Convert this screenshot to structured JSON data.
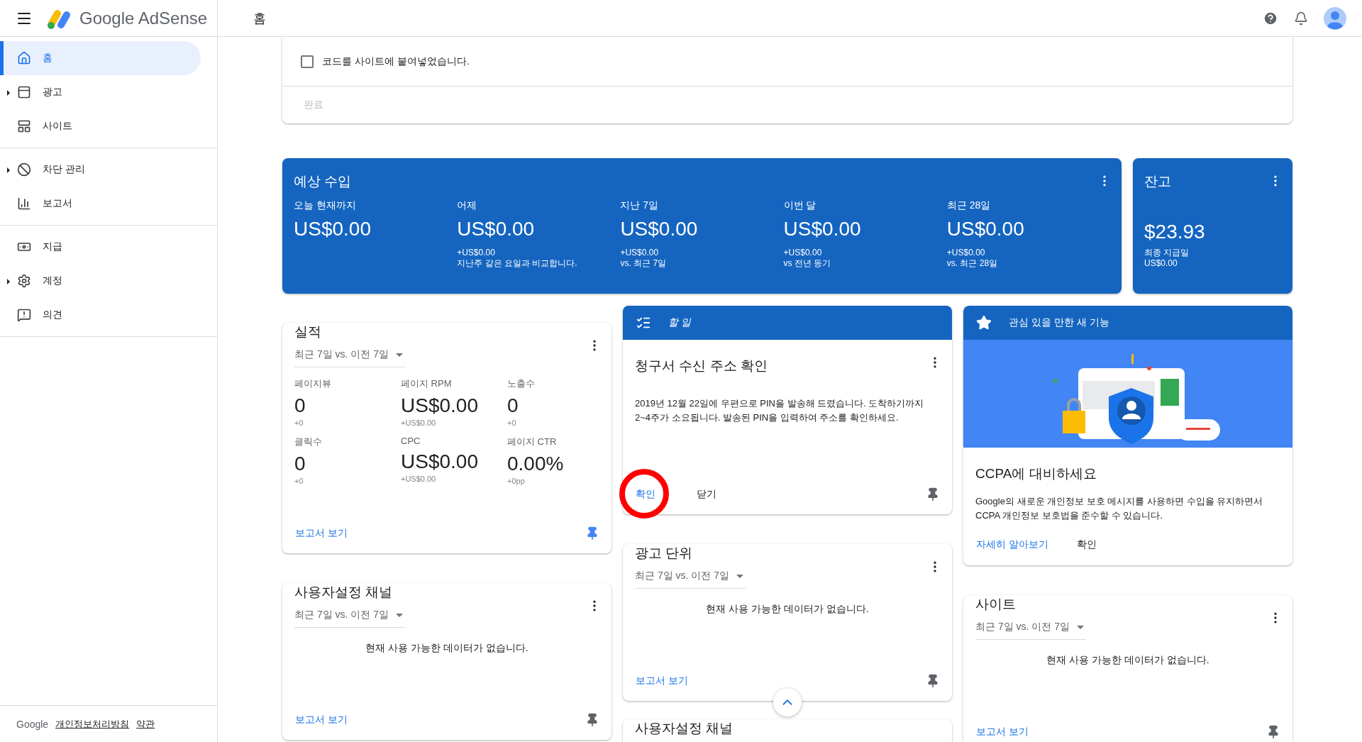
{
  "header": {
    "logo_text": "Google AdSense",
    "title": "홈"
  },
  "sidebar": {
    "groups": [
      {
        "items": [
          {
            "label": "홈",
            "selected": true,
            "expandable": false
          },
          {
            "label": "광고",
            "selected": false,
            "expandable": true
          },
          {
            "label": "사이트",
            "selected": false,
            "expandable": false
          }
        ]
      },
      {
        "items": [
          {
            "label": "차단 관리",
            "selected": false,
            "expandable": true
          },
          {
            "label": "보고서",
            "selected": false,
            "expandable": false
          }
        ]
      },
      {
        "items": [
          {
            "label": "지급",
            "selected": false,
            "expandable": false
          },
          {
            "label": "계정",
            "selected": false,
            "expandable": true
          },
          {
            "label": "의견",
            "selected": false,
            "expandable": false
          }
        ]
      }
    ],
    "footer": {
      "brand": "Google",
      "links": [
        "개인정보처리방침",
        "약관"
      ]
    }
  },
  "setup_card": {
    "checkbox": {
      "label": "코드를 사이트에 붙여넣었습니다.",
      "checked": false
    },
    "done_button": {
      "label": "완료",
      "disabled": true
    }
  },
  "earnings": {
    "title": "예상 수입",
    "metrics": [
      {
        "label": "오늘 현재까지",
        "value": "US$0.00"
      },
      {
        "label": "어제",
        "value": "US$0.00",
        "delta": "+US$0.00",
        "compare": "지난주 같은 요일과 비교합니다."
      },
      {
        "label": "지난 7일",
        "value": "US$0.00",
        "delta": "+US$0.00",
        "compare": "vs. 최근 7일"
      },
      {
        "label": "이번 달",
        "value": "US$0.00",
        "delta": "+US$0.00",
        "compare": "vs 전년 동기"
      },
      {
        "label": "최근 28일",
        "value": "US$0.00",
        "delta": "+US$0.00",
        "compare": "vs. 최근 28일"
      }
    ]
  },
  "balance": {
    "title": "잔고",
    "value": "$23.93",
    "note": "최종 지급일",
    "note_value": "US$0.00"
  },
  "columns": [
    {
      "cards": [
        {
          "kind": "report",
          "title": "실적",
          "period": "최근 7일 vs. 이전 7일",
          "metrics": [
            {
              "label": "페이지뷰",
              "value": "0",
              "delta": "+0"
            },
            {
              "label": "페이지 RPM",
              "value": "US$0.00",
              "delta": "+US$0.00"
            },
            {
              "label": "노출수",
              "value": "0",
              "delta": "+0"
            },
            {
              "label": "클릭수",
              "value": "0",
              "delta": "+0"
            },
            {
              "label": "CPC",
              "value": "US$0.00",
              "delta": "+US$0.00"
            },
            {
              "label": "페이지 CTR",
              "value": "0.00%",
              "delta": "+0pp"
            }
          ],
          "link": "보고서 보기",
          "pinned": true
        },
        {
          "kind": "report",
          "title": "사용자설정 채널",
          "period": "최근 7일 vs. 이전 7일",
          "empty": "현재 사용 가능한 데이터가 없습니다.",
          "link": "보고서 보기",
          "pinned": false
        }
      ]
    },
    {
      "cards": [
        {
          "kind": "todo",
          "header": "할 일",
          "title": "청구서 수신 주소 확인",
          "body": "2019년 12월 22일에 우편으로 PIN을 발송해 드렸습니다. 도착하기까지 2~4주가 소요됩니다. 발송된 PIN을 입력하여 주소를 확인하세요.",
          "actions": [
            {
              "label": "확인",
              "primary": true,
              "circled": true
            },
            {
              "label": "닫기",
              "primary": false,
              "circled": false
            }
          ],
          "pinned": false
        },
        {
          "kind": "report",
          "title": "광고 단위",
          "period": "최근 7일 vs. 이전 7일",
          "empty": "현재 사용 가능한 데이터가 없습니다.",
          "link": "보고서 보기",
          "pinned": false
        },
        {
          "kind": "report",
          "title": "사용자설정 채널"
        }
      ]
    },
    {
      "cards": [
        {
          "kind": "feature",
          "header": "관심 있을 만한 새 기능",
          "title": "CCPA에 대비하세요",
          "body": "Google의 새로운 개인정보 보호 메시지를 사용하면 수입을 유지하면서 CCPA 개인정보 보호법을 준수할 수 있습니다.",
          "actions": [
            {
              "label": "자세히 알아보기",
              "primary": true
            },
            {
              "label": "확인",
              "primary": false
            }
          ]
        },
        {
          "kind": "report",
          "title": "사이트",
          "period": "최근 7일 vs. 이전 7일",
          "empty": "현재 사용 가능한 데이터가 없습니다.",
          "link": "보고서 보기",
          "pinned": false
        }
      ]
    }
  ]
}
